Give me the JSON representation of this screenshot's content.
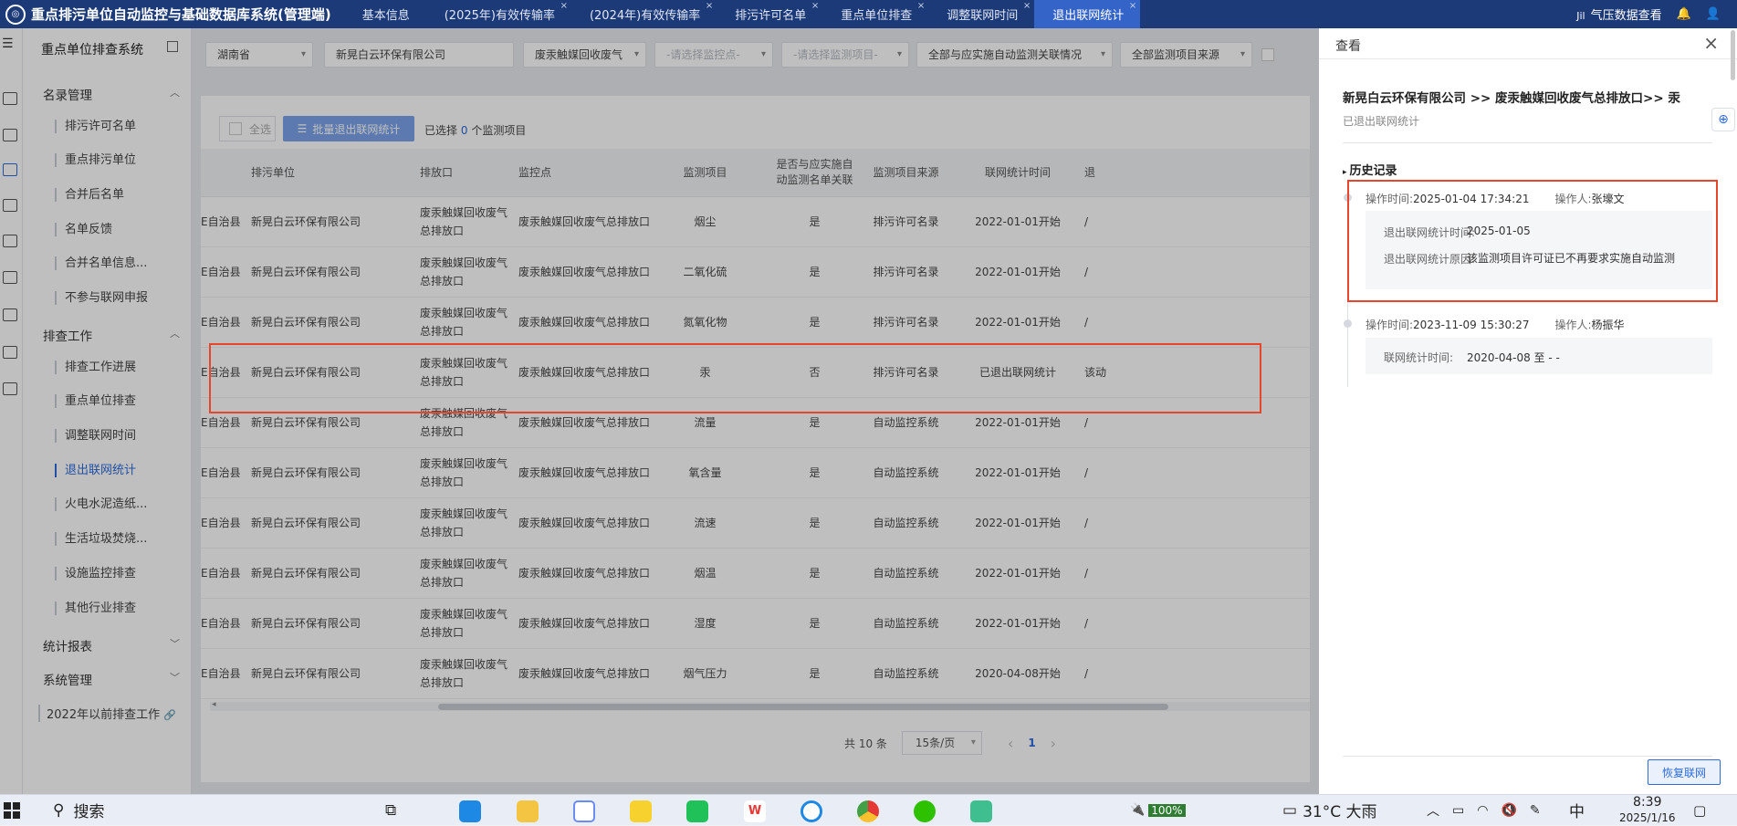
{
  "app": {
    "title": "重点排污单位自动监控与基础数据库系统(管理端)",
    "tabs": [
      {
        "label": "基本信息"
      },
      {
        "label": "(2025年)有效传输率"
      },
      {
        "label": "(2024年)有效传输率"
      },
      {
        "label": "排污许可名单"
      },
      {
        "label": "重点单位排查"
      },
      {
        "label": "调整联网时间"
      },
      {
        "label": "退出联网统计"
      }
    ],
    "active_tab": "退出联网统计",
    "top_right": {
      "weather_prefix": "Jil",
      "weather_link": "气压数据查看"
    }
  },
  "sidebar": {
    "title": "重点单位排查系统",
    "groups": [
      {
        "label": "名录管理",
        "items": [
          {
            "label": "排污许可名单"
          },
          {
            "label": "重点排污单位"
          },
          {
            "label": "合并后名单"
          },
          {
            "label": "名单反馈"
          },
          {
            "label": "合并名单信息..."
          },
          {
            "label": "不参与联网申报"
          }
        ]
      },
      {
        "label": "排查工作",
        "items": [
          {
            "label": "排查工作进展"
          },
          {
            "label": "重点单位排查"
          },
          {
            "label": "调整联网时间"
          },
          {
            "label": "退出联网统计"
          },
          {
            "label": "火电水泥造纸..."
          },
          {
            "label": "生活垃圾焚烧..."
          },
          {
            "label": "设施监控排查"
          },
          {
            "label": "其他行业排查"
          }
        ]
      },
      {
        "label": "统计报表",
        "items": []
      },
      {
        "label": "系统管理",
        "items": []
      }
    ],
    "old_work": "2022年以前排查工作"
  },
  "filters": {
    "province": "湖南省",
    "company": "新晃白云环保有限公司",
    "category": "废汞触媒回收废气",
    "point_ph": "-请选择监控点-",
    "item_ph": "-请选择监测项目-",
    "relation": "全部与应实施自动监测关联情况",
    "source": "全部监测项目来源"
  },
  "toolbar": {
    "select_all": "全选",
    "batch_exit": "批量退出联网统计",
    "selected_prefix": "已选择",
    "selected_count": "0",
    "selected_suffix": "个监测项目"
  },
  "table": {
    "headers": {
      "county": "",
      "unit": "排污单位",
      "outlet": "排放口",
      "point": "监控点",
      "item": "监测项目",
      "relation": "是否与应实施自动监测名单关联",
      "source": "监测项目来源",
      "time": "联网统计时间",
      "extra": "退"
    },
    "rows": [
      {
        "county": "E自治县",
        "unit": "新晃白云环保有限公司",
        "outlet": "废汞触媒回收废气总排放口",
        "point": "废汞触媒回收废气总排放口",
        "item": "烟尘",
        "relation": "是",
        "source": "排污许可名录",
        "time": "2022-01-01开始",
        "extra": "/"
      },
      {
        "county": "E自治县",
        "unit": "新晃白云环保有限公司",
        "outlet": "废汞触媒回收废气总排放口",
        "point": "废汞触媒回收废气总排放口",
        "item": "二氧化硫",
        "relation": "是",
        "source": "排污许可名录",
        "time": "2022-01-01开始",
        "extra": "/"
      },
      {
        "county": "E自治县",
        "unit": "新晃白云环保有限公司",
        "outlet": "废汞触媒回收废气总排放口",
        "point": "废汞触媒回收废气总排放口",
        "item": "氮氧化物",
        "relation": "是",
        "source": "排污许可名录",
        "time": "2022-01-01开始",
        "extra": "/"
      },
      {
        "county": "E自治县",
        "unit": "新晃白云环保有限公司",
        "outlet": "废汞触媒回收废气总排放口",
        "point": "废汞触媒回收废气总排放口",
        "item": "汞",
        "relation": "否",
        "source": "排污许可名录",
        "time": "已退出联网统计",
        "extra": "该动"
      },
      {
        "county": "E自治县",
        "unit": "新晃白云环保有限公司",
        "outlet": "废汞触媒回收废气总排放口",
        "point": "废汞触媒回收废气总排放口",
        "item": "流量",
        "relation": "是",
        "source": "自动监控系统",
        "time": "2022-01-01开始",
        "extra": "/"
      },
      {
        "county": "E自治县",
        "unit": "新晃白云环保有限公司",
        "outlet": "废汞触媒回收废气总排放口",
        "point": "废汞触媒回收废气总排放口",
        "item": "氧含量",
        "relation": "是",
        "source": "自动监控系统",
        "time": "2022-01-01开始",
        "extra": "/"
      },
      {
        "county": "E自治县",
        "unit": "新晃白云环保有限公司",
        "outlet": "废汞触媒回收废气总排放口",
        "point": "废汞触媒回收废气总排放口",
        "item": "流速",
        "relation": "是",
        "source": "自动监控系统",
        "time": "2022-01-01开始",
        "extra": "/"
      },
      {
        "county": "E自治县",
        "unit": "新晃白云环保有限公司",
        "outlet": "废汞触媒回收废气总排放口",
        "point": "废汞触媒回收废气总排放口",
        "item": "烟温",
        "relation": "是",
        "source": "自动监控系统",
        "time": "2022-01-01开始",
        "extra": "/"
      },
      {
        "county": "E自治县",
        "unit": "新晃白云环保有限公司",
        "outlet": "废汞触媒回收废气总排放口",
        "point": "废汞触媒回收废气总排放口",
        "item": "湿度",
        "relation": "是",
        "source": "自动监控系统",
        "time": "2022-01-01开始",
        "extra": "/"
      },
      {
        "county": "E自治县",
        "unit": "新晃白云环保有限公司",
        "outlet": "废汞触媒回收废气总排放口",
        "point": "废汞触媒回收废气总排放口",
        "item": "烟气压力",
        "relation": "是",
        "source": "自动监控系统",
        "time": "2020-04-08开始",
        "extra": "/"
      }
    ]
  },
  "pager": {
    "total": "共 10 条",
    "page_size": "15条/页",
    "current": "1",
    "prev": "‹",
    "next": "›"
  },
  "drawer": {
    "title": "查看",
    "close": "×",
    "breadcrumb": "新晃白云环保有限公司 >> 废汞触媒回收废气总排放口>> 汞",
    "status": "已退出联网统计",
    "history_title": "历史记录",
    "history": [
      {
        "time_label": "操作时间:",
        "time": "2025-01-04 17:34:21",
        "op_label": "操作人:",
        "operator": "张壕文",
        "details": [
          {
            "label": "退出联网统计时间:",
            "value": "2025-01-05"
          },
          {
            "label": "退出联网统计原因:",
            "value": "该监测项目许可证已不再要求实施自动监测"
          }
        ]
      },
      {
        "time_label": "操作时间:",
        "time": "2023-11-09 15:30:27",
        "op_label": "操作人:",
        "operator": "杨振华",
        "details": [
          {
            "label": "联网统计时间:",
            "value": "2020-04-08 至 - -"
          }
        ]
      }
    ],
    "restore_button": "恢复联网"
  },
  "taskbar": {
    "search": "搜索",
    "battery": "100%",
    "weather": "31°C 大雨",
    "ime": "中",
    "time": "8:39",
    "date": "2025/1/16"
  },
  "colors": {
    "topbar": "#1d3a78",
    "active_tab": "#3564c8",
    "accent": "#2f6bd9",
    "highlight": "#e8462c"
  }
}
